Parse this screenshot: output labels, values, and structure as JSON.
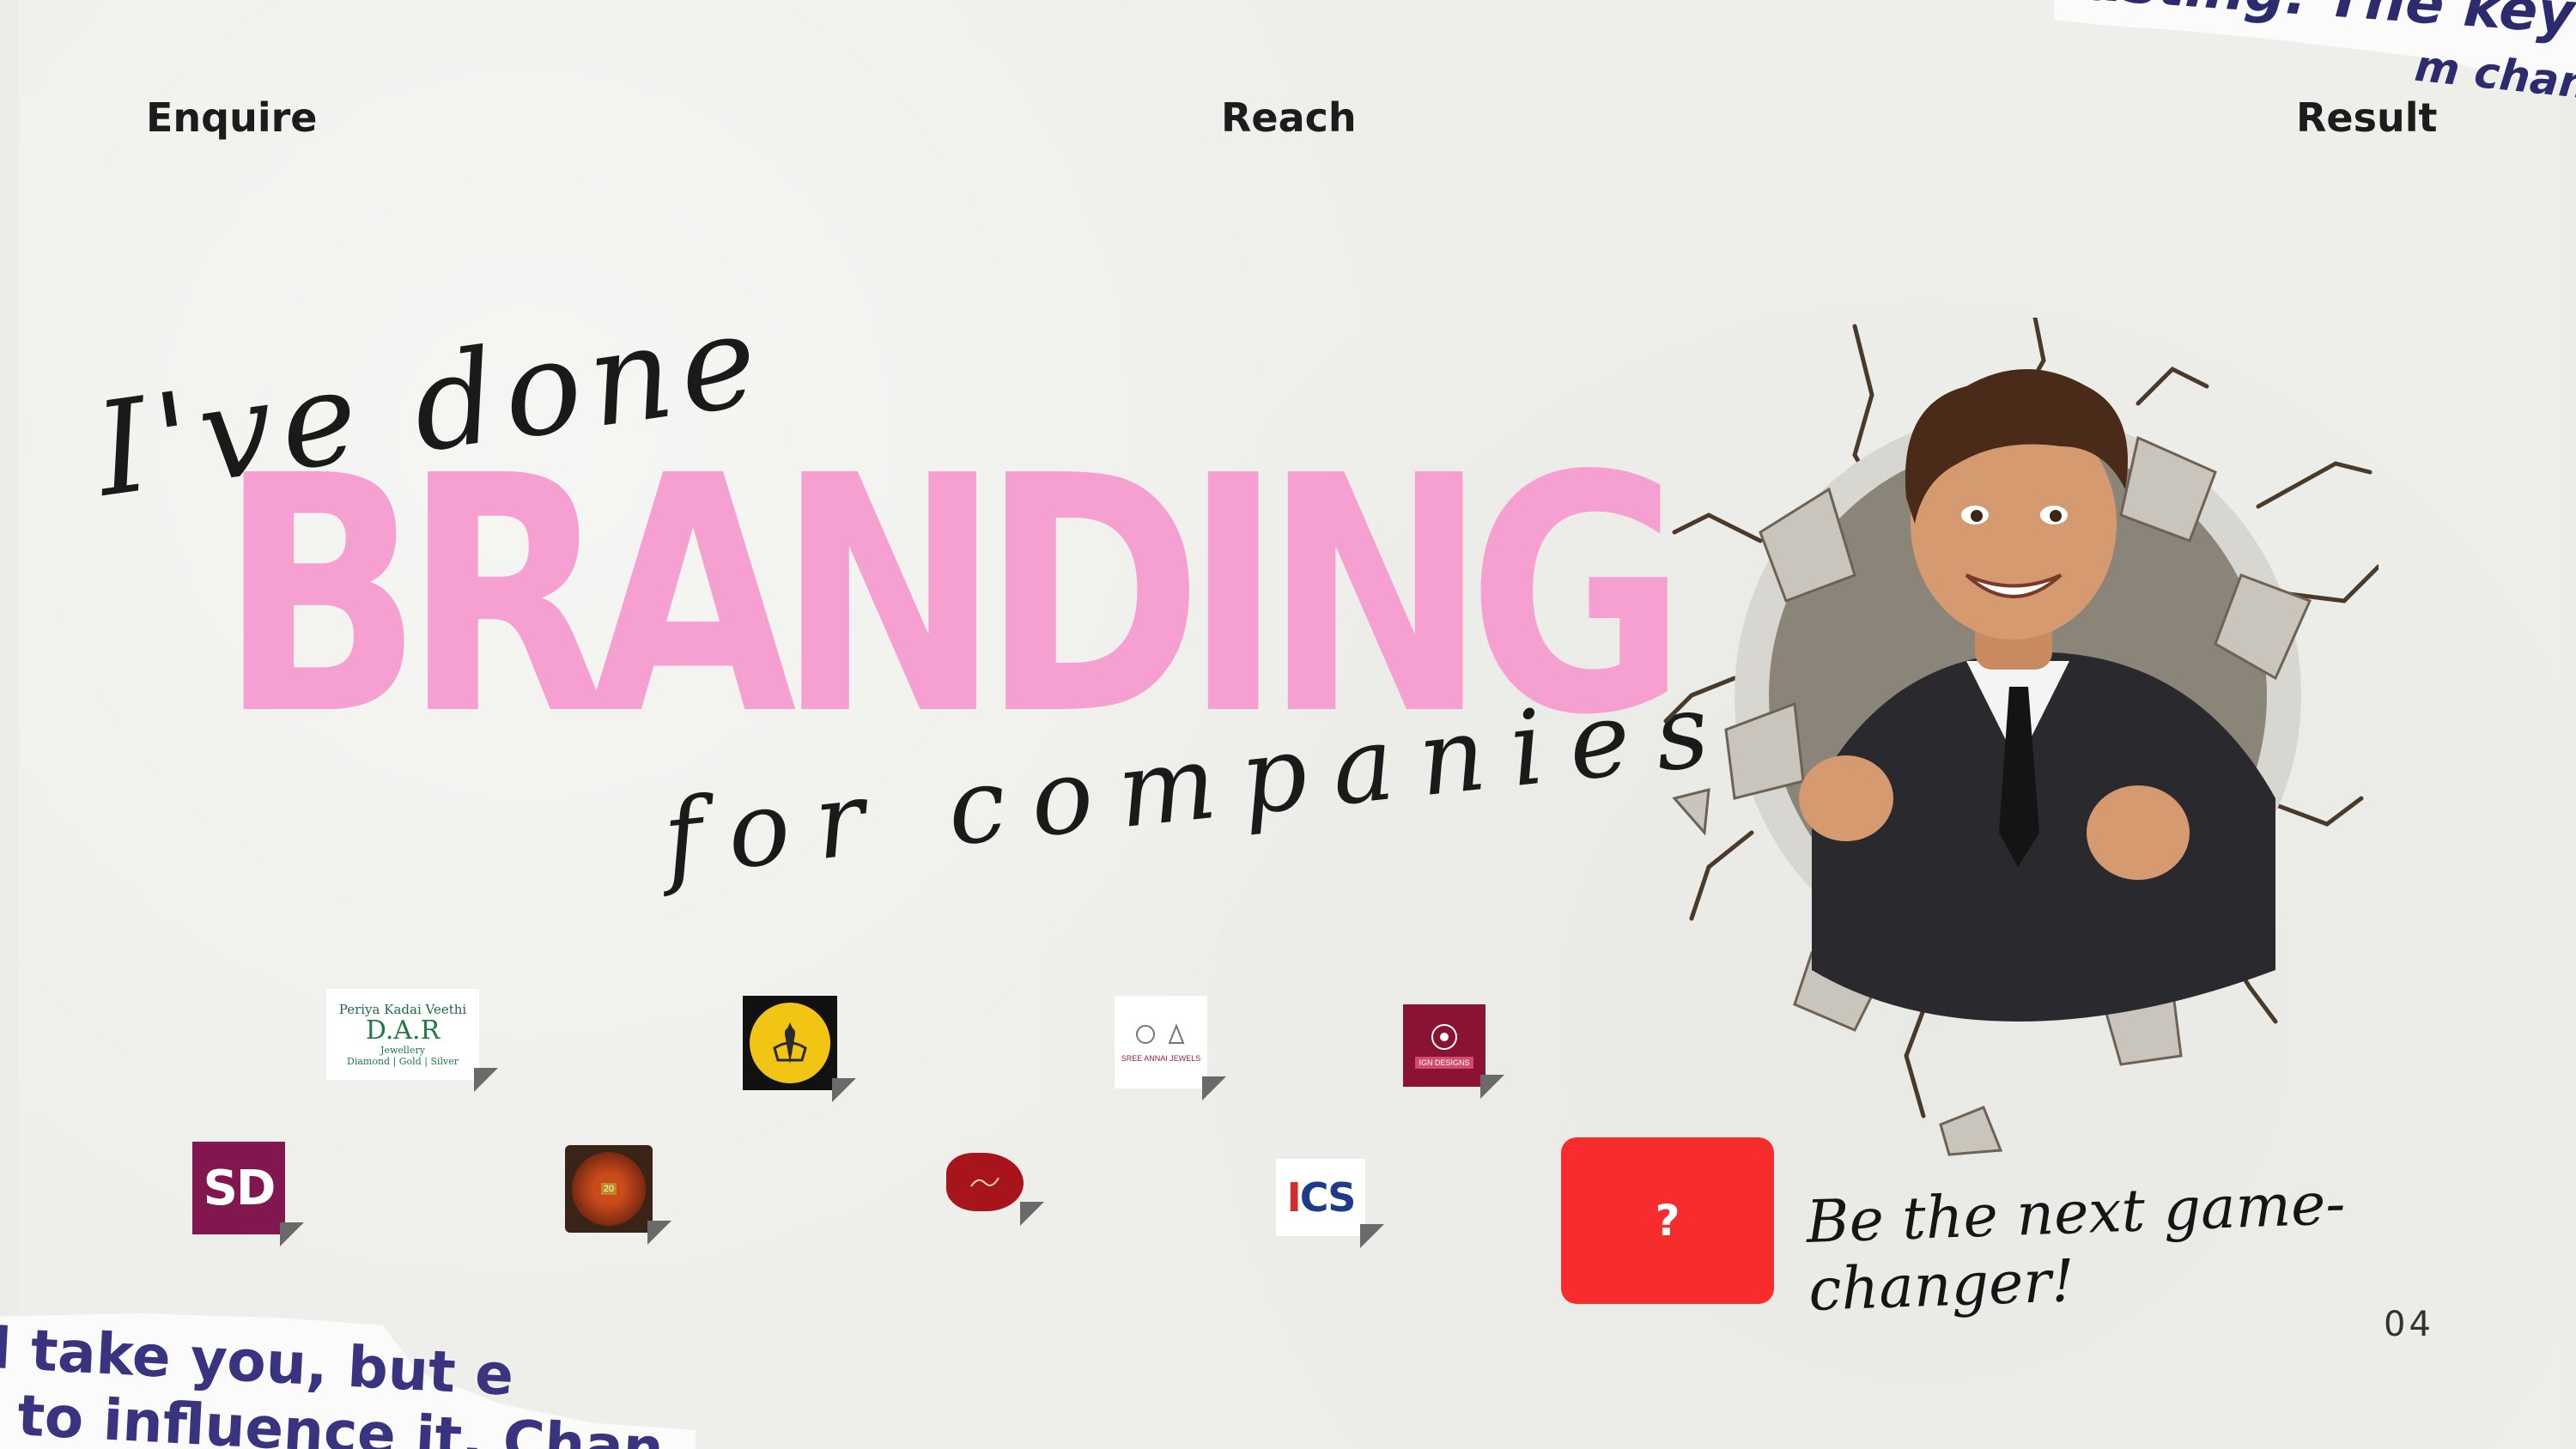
{
  "nav": {
    "enquire": "Enquire",
    "reach": "Reach",
    "result": "Result"
  },
  "headline": {
    "intro_script": "I've done",
    "main": "BRANDING",
    "outro_script": "for companies."
  },
  "logos": {
    "dar": {
      "line1": "Periya Kadai Veethi",
      "line2": "D.A.R",
      "line3": "Jewellery",
      "line4": "Diamond | Gold | Silver"
    },
    "sree": {
      "text": "SREE ANNAI JEWELS"
    },
    "ign": {
      "text": "IGN DESIGNS"
    },
    "sd": {
      "text": "SD"
    },
    "food": {
      "text": "20"
    },
    "ics": {
      "text_a": "I",
      "text_b": "CS"
    }
  },
  "cta": {
    "box_label": "?",
    "tagline": "Be the next game-changer!"
  },
  "page_number": "04",
  "torn_top_right": {
    "line1": "rasting. The key to",
    "line2": "m chang"
  },
  "torn_bottom_left": {
    "line1": "l take you, but e",
    "line2": "to influence it. Chan"
  },
  "colors": {
    "branding_pink": "#f6a0d2",
    "cta_red": "#f72c2c",
    "scrap_ink": "#2b2b6e"
  }
}
